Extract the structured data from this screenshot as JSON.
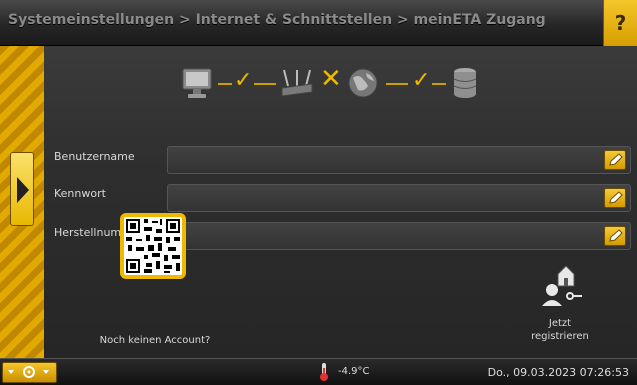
{
  "header": {
    "title": "Systemeinstellungen > Internet & Schnittstellen > meinETA Zugang",
    "help_label": "?"
  },
  "status": {
    "connection_steps": [
      "pc-icon",
      "router-icon",
      "globe-icon",
      "database-icon"
    ],
    "step_states": [
      "ok",
      "fail",
      "ok"
    ],
    "ok_glyph": "✓",
    "fail_glyph": "✕",
    "accent_color": "#f0b800"
  },
  "form": {
    "username_label": "Benutzername",
    "username_value": "",
    "password_label": "Kennwort",
    "password_value": "",
    "serial_label": "Herstellnummer",
    "serial_value": ""
  },
  "account": {
    "no_account_label": "Noch keinen Account?",
    "register_label_line1": "Jetzt",
    "register_label_line2": "registrieren"
  },
  "footer": {
    "temperature": "-4.9°C",
    "datetime": "Do., 09.03.2023 07:26:53"
  }
}
